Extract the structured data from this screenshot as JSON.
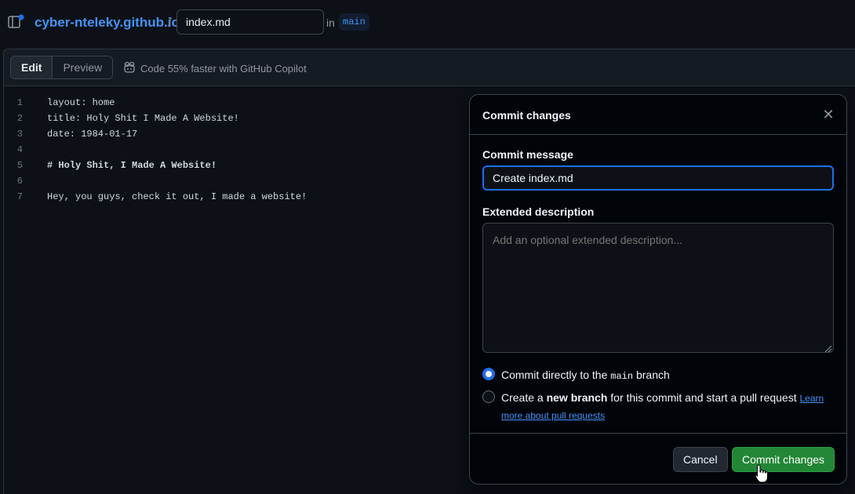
{
  "header": {
    "repo_name": "cyber-nteleky.github.io",
    "separator": "/",
    "filename_value": "index.md",
    "in_label": "in",
    "branch": "main"
  },
  "editor": {
    "tabs": [
      {
        "label": "Edit",
        "active": true
      },
      {
        "label": "Preview",
        "active": false
      }
    ],
    "copilot_note": "Code 55% faster with GitHub Copilot",
    "lines": [
      {
        "num": "1",
        "text": "layout: home"
      },
      {
        "num": "2",
        "text": "title: Holy Shit I Made A Website!"
      },
      {
        "num": "3",
        "text": "date: 1984-01-17"
      },
      {
        "num": "4",
        "text": ""
      },
      {
        "num": "5",
        "text": "# Holy Shit, I Made A Website!"
      },
      {
        "num": "6",
        "text": ""
      },
      {
        "num": "7",
        "text": "Hey, you guys, check it out, I made a website!"
      }
    ]
  },
  "dialog": {
    "title": "Commit changes",
    "commit_message_label": "Commit message",
    "commit_message_value": "Create index.md",
    "extended_label": "Extended description",
    "extended_placeholder": "Add an optional extended description...",
    "option_direct_prefix": "Commit directly to the ",
    "option_direct_branch": "main",
    "option_direct_suffix": " branch",
    "option_new_prefix": "Create a ",
    "option_new_bold": "new branch",
    "option_new_suffix": " for this commit and start a pull request ",
    "learn_more": "Learn more about pull requests",
    "cancel_label": "Cancel",
    "commit_label": "Commit changes"
  },
  "colors": {
    "accent": "#1f6feb",
    "link": "#4493f8",
    "primary_button": "#238636",
    "background": "#0d1117"
  },
  "icons": [
    "file-tree-icon",
    "copilot-icon",
    "close-icon",
    "resize-handle-icon",
    "pointer-cursor-icon"
  ]
}
